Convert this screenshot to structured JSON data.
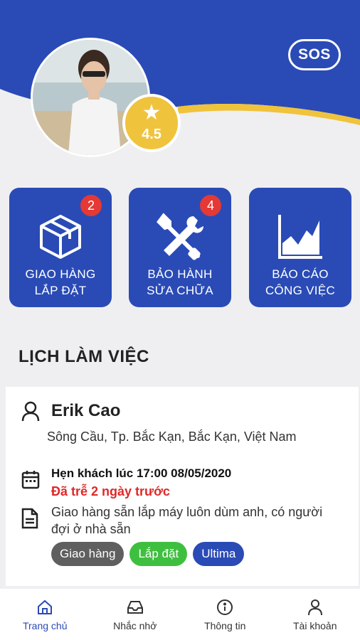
{
  "header": {
    "sos_label": "SOS",
    "rating": "4.5"
  },
  "tiles": [
    {
      "label_line1": "GIAO HÀNG",
      "label_line2": "LẮP ĐẶT",
      "badge": "2",
      "icon": "box-icon"
    },
    {
      "label_line1": "BẢO HÀNH",
      "label_line2": "SỬA CHỮA",
      "badge": "4",
      "icon": "tools-icon"
    },
    {
      "label_line1": "BÁO CÁO",
      "label_line2": "CÔNG VIỆC",
      "badge": "",
      "icon": "chart-icon"
    }
  ],
  "section": {
    "title": "LỊCH LÀM VIỆC"
  },
  "card": {
    "name": "Erik Cao",
    "address": "Sông Cầu, Tp. Bắc Kạn, Bắc Kạn, Việt Nam",
    "appointment": "Hẹn khách lúc 17:00 08/05/2020",
    "late": "Đã trễ 2 ngày trước",
    "note": "Giao hàng sẵn lắp máy luôn dùm anh, có người đợi ở nhà sẵn",
    "tags": [
      {
        "label": "Giao hàng",
        "color": "#5f5f5f"
      },
      {
        "label": "Lắp đặt",
        "color": "#3fbf3f"
      },
      {
        "label": "Ultima",
        "color": "#2a4bb6"
      }
    ]
  },
  "nav": [
    {
      "label": "Trang chủ",
      "icon": "home-icon",
      "active": true
    },
    {
      "label": "Nhắc nhở",
      "icon": "inbox-icon",
      "active": false
    },
    {
      "label": "Thông tin",
      "icon": "info-icon",
      "active": false
    },
    {
      "label": "Tài khoản",
      "icon": "user-icon",
      "active": false
    }
  ],
  "colors": {
    "primary": "#2a4bb6",
    "accent": "#f0c33c",
    "badge": "#e53935",
    "late": "#e02828"
  }
}
